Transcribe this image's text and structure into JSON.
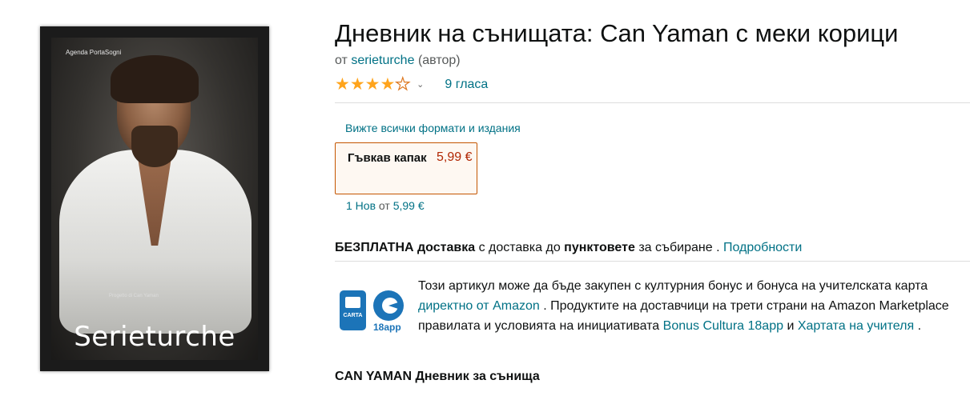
{
  "cover": {
    "series_label": "Agenda PortaSogni",
    "small_text": "Progetto di Can Yaman",
    "author_text": "Serieturche"
  },
  "product": {
    "title": "Дневник на сънищата: Can Yaman с меки корици",
    "by_prefix": "от",
    "author": "serieturche",
    "author_role": "(автор)",
    "rating_stars": 4.0,
    "ratings_count": "9 гласа"
  },
  "formats": {
    "link": "Вижте всички формати и издания",
    "selected": {
      "name": "Гъвкав капак",
      "price": "5,99 €"
    },
    "offers_count": "1 Нов",
    "offers_from": "от",
    "offers_price": "5,99 €"
  },
  "delivery": {
    "free": "БЕЗПЛАТНА доставка",
    "with": "с доставка до",
    "points": "пунктовете",
    "pickup": "за събиране .",
    "details_link": "Подробности"
  },
  "bonus": {
    "card_label": "CARTA",
    "app_label": "18app",
    "line1": "Този артикул може да бъде закупен с културния бонус и бонуса на учителската карта",
    "line2_link": "директно от Amazon",
    "line2_rest": ". Продуктите на доставчици на трети страни на Amazon Marketplace",
    "line3_pre": "правилата и условията на инициативата",
    "line3_link1": "Bonus Cultura 18app",
    "line3_and": "и",
    "line3_link2": "Хартата на учителя",
    "line3_end": "."
  },
  "subtitle": "CAN YAMAN Дневник за сънища",
  "colors": {
    "link": "#007185",
    "price": "#b12704",
    "star": "#ffa41c",
    "selected_border": "#c45500"
  }
}
